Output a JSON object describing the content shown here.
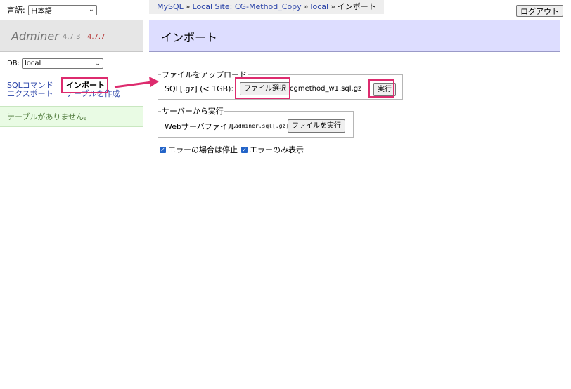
{
  "sidebar": {
    "language_label": "言語:",
    "language_value": "日本語",
    "logo_name": "Adminer",
    "version_current": "4.7.3",
    "version_new": "4.7.7",
    "db_label": "DB:",
    "db_value": "local",
    "links": {
      "sql_command": "SQLコマンド",
      "import": "インポート",
      "export": "エクスポート",
      "create_table": "テーブルを作成"
    },
    "no_tables": "テーブルがありません。"
  },
  "header": {
    "breadcrumb": [
      "MySQL",
      "Local Site: CG-Method_Copy",
      "local",
      "インポート"
    ],
    "separator": "»",
    "logout": "ログアウト",
    "title": "インポート"
  },
  "upload": {
    "legend": "ファイルをアップロード",
    "label": "SQL[.gz] (< 1GB):",
    "file_button": "ファイル選択",
    "file_name": "cgmethod_w1.sql.gz",
    "execute": "実行"
  },
  "server": {
    "legend": "サーバーから実行",
    "label": "Webサーバファイル",
    "file": "adminer.sql[.gz]",
    "execute": "ファイルを実行"
  },
  "options": {
    "stop_on_error": "エラーの場合は停止",
    "stop_on_error_checked": true,
    "errors_only": "エラーのみ表示",
    "errors_only_checked": true
  },
  "colors": {
    "highlight": "#dd2b6e",
    "title_bar": "#ddddff",
    "link": "#2a43a8",
    "version_new": "#b53333",
    "notice_bg": "#e9fbe4"
  }
}
